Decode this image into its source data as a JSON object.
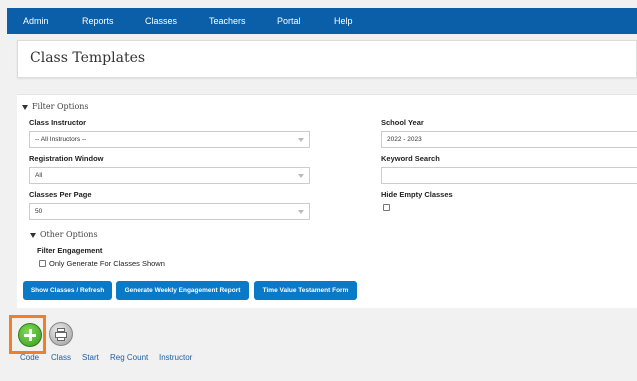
{
  "nav": {
    "items": [
      {
        "label": "Admin"
      },
      {
        "label": "Reports"
      },
      {
        "label": "Classes"
      },
      {
        "label": "Teachers"
      },
      {
        "label": "Portal"
      },
      {
        "label": "Help"
      }
    ]
  },
  "page": {
    "title": "Class Templates"
  },
  "filters": {
    "toggle_label": "Filter Options",
    "class_instructor": {
      "label": "Class Instructor",
      "value": "-- All Instructors --"
    },
    "registration_window": {
      "label": "Registration Window",
      "value": "All"
    },
    "classes_per_page": {
      "label": "Classes Per Page",
      "value": "50"
    },
    "school_year": {
      "label": "School Year",
      "value": "2022 - 2023"
    },
    "keyword_search": {
      "label": "Keyword Search",
      "value": ""
    },
    "hide_empty": {
      "label": "Hide Empty Classes",
      "checked": false
    },
    "other_options": {
      "toggle_label": "Other Options",
      "filter_engagement_label": "Filter Engagement",
      "only_generate_label": "Only Generate For Classes Shown"
    }
  },
  "actions": {
    "show_classes": "Show Classes / Refresh",
    "generate_weekly": "Generate Weekly Engagement Report",
    "time_value": "Time Value Testament Form"
  },
  "icons": {
    "add": "plus-icon",
    "print": "print-icon"
  },
  "table": {
    "columns": [
      "Code",
      "Class",
      "Start",
      "Reg Count",
      "Instructor"
    ]
  },
  "colors": {
    "nav_bg": "#0a5fa8",
    "button_bg": "#0a79c6",
    "highlight": "#f07f2c",
    "link": "#1d5fa6"
  }
}
